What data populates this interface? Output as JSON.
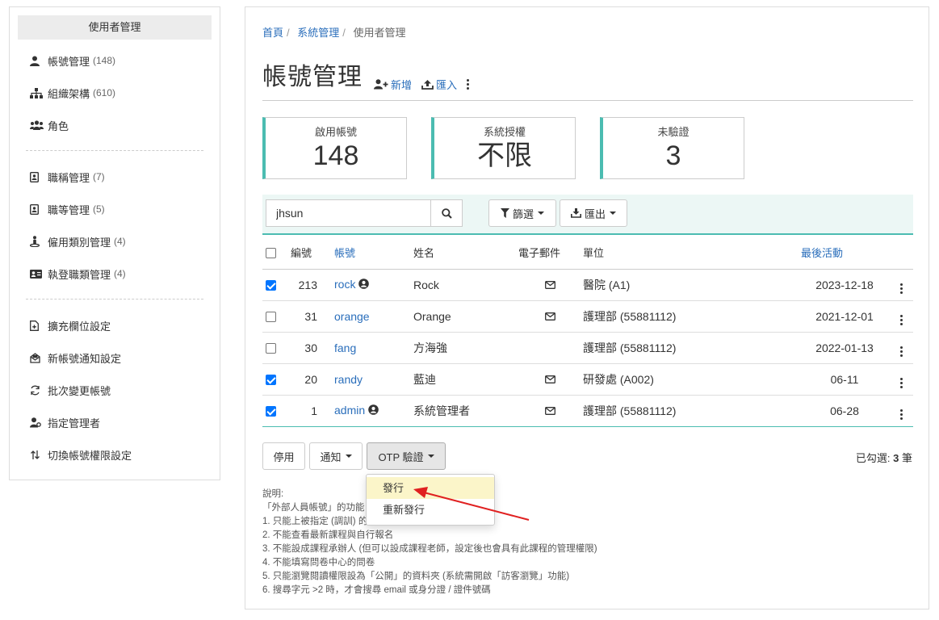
{
  "sidebar": {
    "title": "使用者管理",
    "group1": [
      {
        "label": "帳號管理",
        "count": "(148)",
        "icon": "user-icon"
      },
      {
        "label": "組織架構",
        "count": "(610)",
        "icon": "sitemap-icon"
      },
      {
        "label": "角色",
        "count": "",
        "icon": "users-icon"
      }
    ],
    "group2": [
      {
        "label": "職稱管理",
        "count": "(7)",
        "icon": "id-card-icon"
      },
      {
        "label": "職等管理",
        "count": "(5)",
        "icon": "id-card-icon"
      },
      {
        "label": "僱用類別管理",
        "count": "(4)",
        "icon": "person-pin-icon"
      },
      {
        "label": "執登職類管理",
        "count": "(4)",
        "icon": "id-badge-icon"
      }
    ],
    "group3": [
      {
        "label": "擴充欄位設定",
        "icon": "file-plus-icon"
      },
      {
        "label": "新帳號通知設定",
        "icon": "mail-settings-icon"
      },
      {
        "label": "批次變更帳號",
        "icon": "sync-icon"
      },
      {
        "label": "指定管理者",
        "icon": "user-gear-icon"
      },
      {
        "label": "切換帳號權限設定",
        "icon": "swap-icon"
      }
    ]
  },
  "breadcrumb": {
    "home": "首頁",
    "system": "系統管理",
    "current": "使用者管理"
  },
  "page": {
    "title": "帳號管理",
    "add_label": "新增",
    "import_label": "匯入"
  },
  "stats": [
    {
      "label": "啟用帳號",
      "value": "148"
    },
    {
      "label": "系統授權",
      "value": "不限"
    },
    {
      "label": "未驗證",
      "value": "3"
    }
  ],
  "search": {
    "value": "jhsun"
  },
  "filter_label": "篩選",
  "export_label": "匯出",
  "table": {
    "headers": {
      "id": "編號",
      "account": "帳號",
      "name": "姓名",
      "email": "電子郵件",
      "unit": "單位",
      "last": "最後活動"
    },
    "rows": [
      {
        "checked": true,
        "id": "213",
        "account": "rock",
        "admin": true,
        "name": "Rock",
        "email": true,
        "unit": "醫院 (A1)",
        "last": "2023-12-18"
      },
      {
        "checked": false,
        "id": "31",
        "account": "orange",
        "admin": false,
        "name": "Orange",
        "email": true,
        "unit": "護理部 (55881112)",
        "last": "2021-12-01"
      },
      {
        "checked": false,
        "id": "30",
        "account": "fang",
        "admin": false,
        "name": "方海強",
        "email": false,
        "unit": "護理部 (55881112)",
        "last": "2022-01-13"
      },
      {
        "checked": true,
        "id": "20",
        "account": "randy",
        "admin": false,
        "name": "藍迪",
        "email": true,
        "unit": "研發處 (A002)",
        "last": "06-11"
      },
      {
        "checked": true,
        "id": "1",
        "account": "admin",
        "admin": true,
        "name": "系統管理者",
        "email": true,
        "unit": "護理部 (55881112)",
        "last": "06-28"
      }
    ]
  },
  "bulk": {
    "disable": "停用",
    "notify": "通知",
    "otp": "OTP 驗證"
  },
  "selected": {
    "prefix": "已勾選:",
    "count": "3",
    "suffix": "筆"
  },
  "otp_menu": {
    "issue": "發行",
    "reissue": "重新發行"
  },
  "notes": {
    "title": "說明:",
    "lines": [
      "「外部人員帳號」的功能",
      "1. 只能上被指定 (調訓) 的課程",
      "2. 不能查看最新課程與自行報名",
      "3. 不能設成課程承辦人 (但可以設成課程老師，設定後也會具有此課程的管理權限)",
      "4. 不能填寫問卷中心的問卷",
      "5. 只能瀏覽閱讀權限設為「公開」的資料夾 (系統需開啟「訪客瀏覽」功能)",
      "6. 搜尋字元 >2 時，才會搜尋 email 或身分證 / 證件號碼"
    ]
  },
  "colors": {
    "accent": "#4bbcb1",
    "link": "#2a6ebb",
    "arrow": "#e02020",
    "highlight": "#fbf5c9"
  }
}
